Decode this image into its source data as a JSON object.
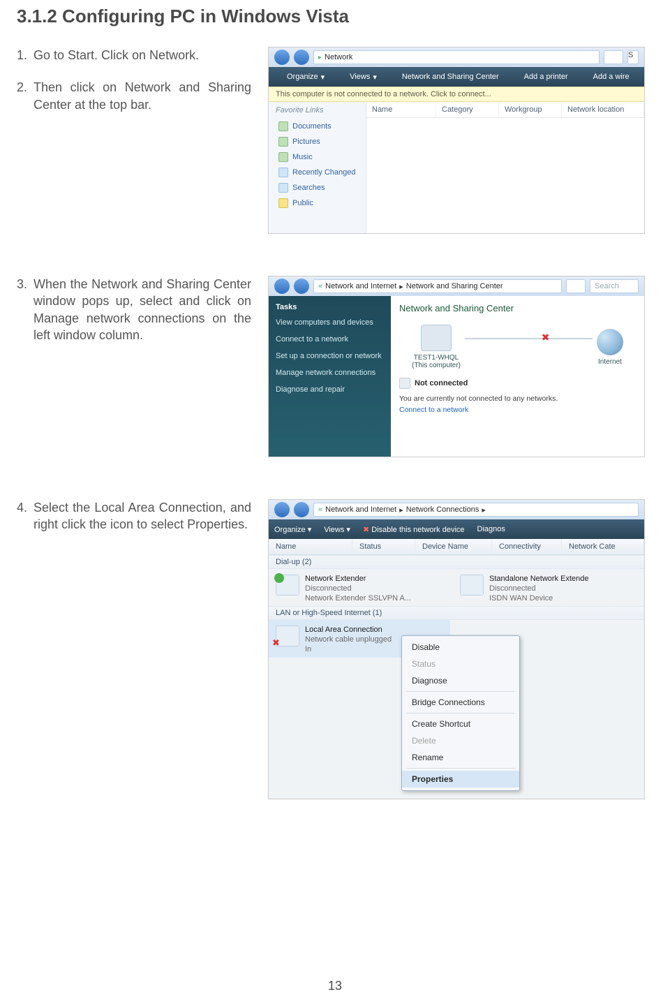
{
  "page_number": "13",
  "title": "3.1.2  Configuring PC in Windows Vista",
  "steps": {
    "s1": "Go to Start. Click on Network.",
    "s2": "Then click on Network and Sharing Center at the top bar.",
    "s3": "When the Network and Sharing Center window pops up, select and click on Manage network connections on the left window column.",
    "s4": "Select the Local Area Connection, and right click the icon to select Properties."
  },
  "shot1": {
    "breadcrumb_arrow": "▸",
    "breadcrumb_label": "Network",
    "search_hint": "S",
    "toolbar": {
      "organize": "Organize",
      "views": "Views",
      "nsc": "Network and Sharing Center",
      "addprinter": "Add a printer",
      "addwire": "Add a wire"
    },
    "info_strip": "This computer is not connected to a network. Click to connect...",
    "favorites_header": "Favorite Links",
    "favorites": [
      "Documents",
      "Pictures",
      "Music",
      "Recently Changed",
      "Searches",
      "Public"
    ],
    "columns": [
      "Name",
      "Category",
      "Workgroup",
      "Network location"
    ]
  },
  "shot2": {
    "breadcrumb": [
      "«",
      "Network and Internet",
      "▸",
      "Network and Sharing Center"
    ],
    "search_placeholder": "Search",
    "tasks_header": "Tasks",
    "tasks": [
      "View computers and devices",
      "Connect to a network",
      "Set up a connection or network",
      "Manage network connections",
      "Diagnose and repair"
    ],
    "main_title": "Network and Sharing Center",
    "node_pc_name": "TEST1-WHQL",
    "node_pc_sub": "(This computer)",
    "node_internet": "Internet",
    "not_connected": "Not connected",
    "not_connected_msg": "You are currently not connected to any networks.",
    "connect_link": "Connect to a network"
  },
  "shot3": {
    "breadcrumb": [
      "«",
      "Network and Internet",
      "▸",
      "Network Connections",
      "▸"
    ],
    "toolbar": {
      "organize": "Organize",
      "views": "Views",
      "disable": "Disable this network device",
      "diagnose": "Diagnos"
    },
    "columns": [
      "Name",
      "Status",
      "Device Name",
      "Connectivity",
      "Network Cate"
    ],
    "group_dialup": "Dial-up (2)",
    "group_lan": "LAN or High-Speed Internet (1)",
    "conn_ne": {
      "name": "Network Extender",
      "status": "Disconnected",
      "device": "Network Extender SSLVPN A..."
    },
    "conn_sne": {
      "name": "Standalone Network Extende",
      "status": "Disconnected",
      "device": "ISDN WAN Device"
    },
    "conn_lac": {
      "name": "Local Area Connection",
      "status": "Network cable unplugged",
      "device": "In"
    },
    "context_menu": [
      "Disable",
      "Status",
      "Diagnose",
      "Bridge Connections",
      "Create Shortcut",
      "Delete",
      "Rename",
      "Properties"
    ]
  }
}
